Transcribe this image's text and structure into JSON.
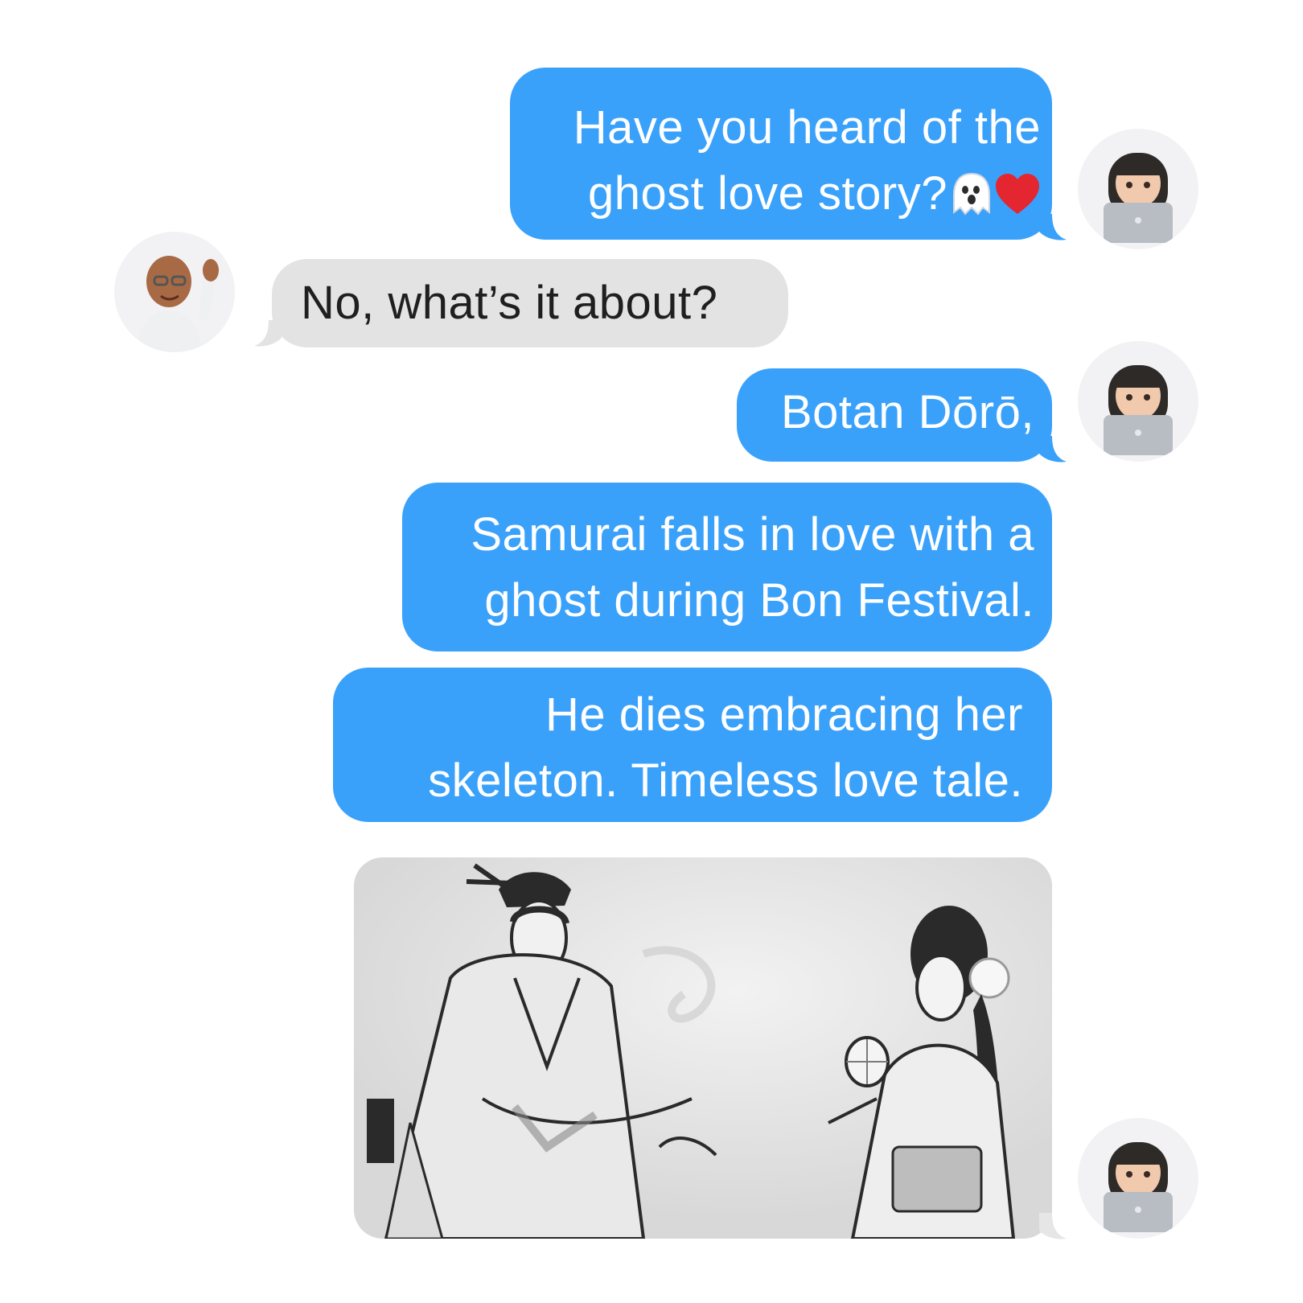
{
  "messages": {
    "m1": {
      "lines": [
        "Have you heard of the",
        "ghost love story?"
      ],
      "emoji_icons": [
        "ghost-emoji",
        "red-heart-emoji"
      ]
    },
    "m2": {
      "lines": [
        "No, what’s it about?"
      ]
    },
    "m3": {
      "lines": [
        "Botan Dōrō,"
      ]
    },
    "m4": {
      "lines": [
        "Samurai falls in love with a",
        "ghost during Bon Festival."
      ]
    },
    "m5": {
      "lines": [
        "He dies embracing her",
        "skeleton. Timeless love tale."
      ]
    },
    "m6": {
      "image": "samurai-and-ghost-woman-with-lantern-illustration"
    }
  },
  "avatars": {
    "sender": "woman-with-laptop-memoji",
    "receiver": "man-waving-memoji"
  },
  "colors": {
    "sent_bubble": "#3aa1fb",
    "received_bubble": "#e3e3e3",
    "sent_text": "#ffffff",
    "received_text": "#1f1f1f"
  }
}
